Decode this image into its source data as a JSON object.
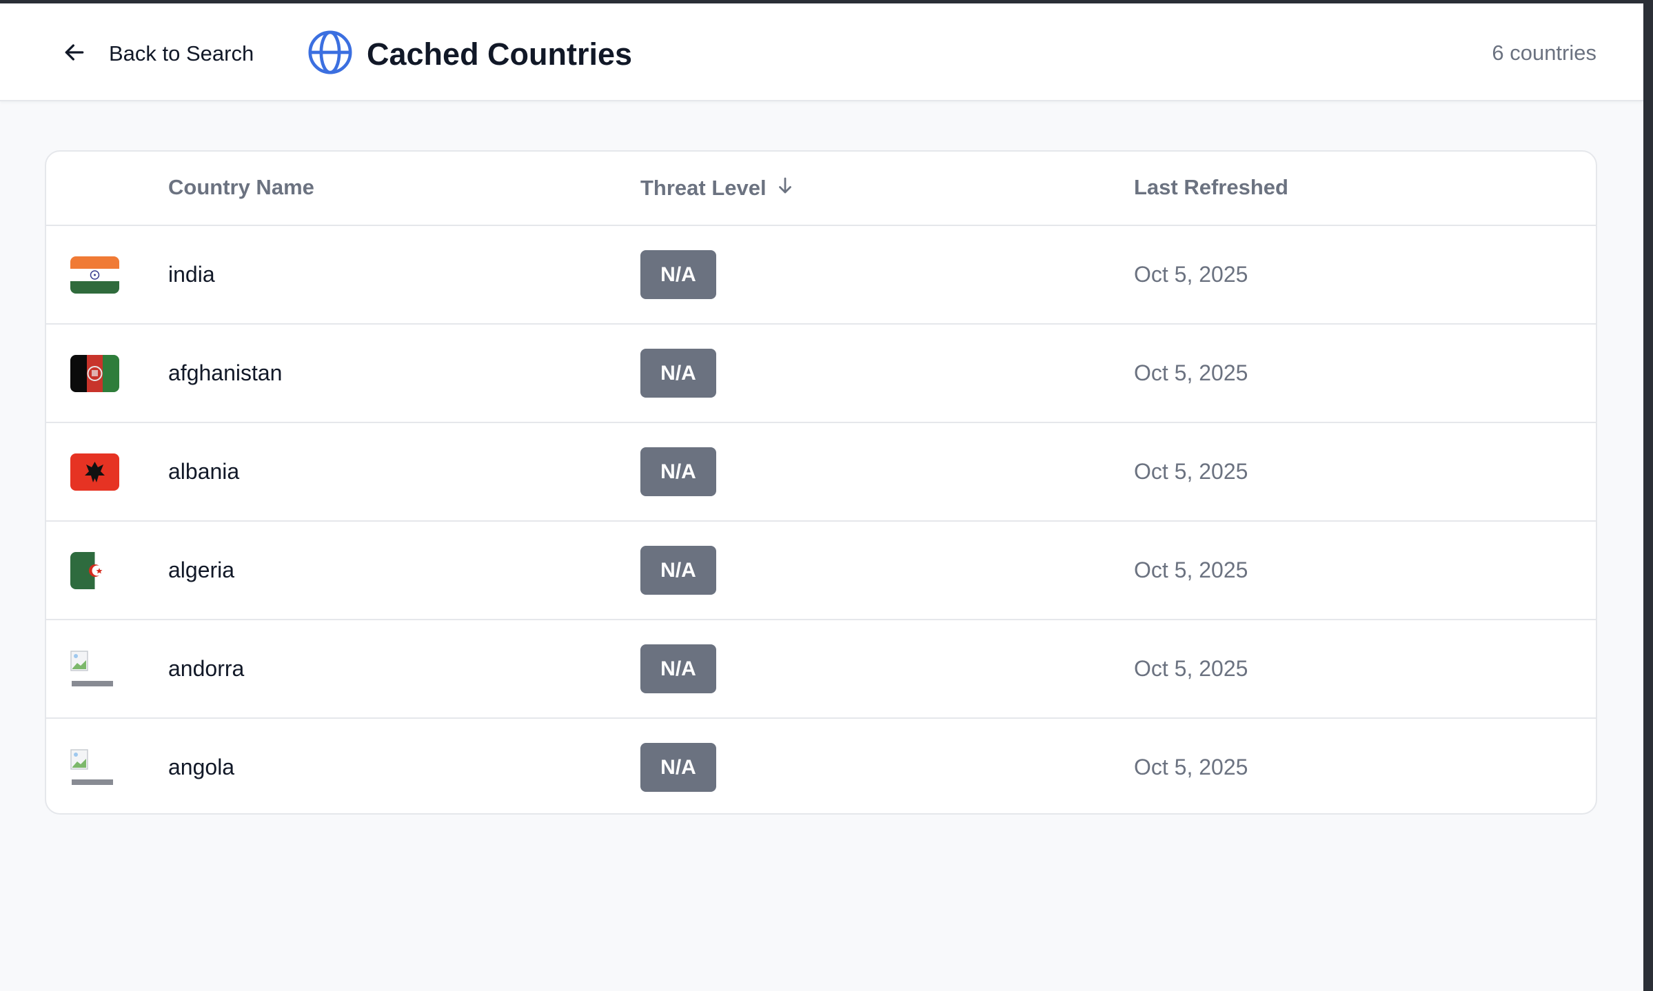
{
  "header": {
    "back_label": "Back to Search",
    "title": "Cached Countries",
    "count": "6 countries",
    "accent": "#3b6fe0"
  },
  "table": {
    "columns": [
      "",
      "Country Name",
      "Threat Level",
      "Last Refreshed"
    ],
    "sort": {
      "column": "Threat Level",
      "direction": "descending",
      "icon": "arrow-down-icon"
    },
    "rows": [
      {
        "flag": "india-flag",
        "name": "india",
        "threat": "N/A",
        "refreshed": "Oct 5, 2025"
      },
      {
        "flag": "afghanistan-flag",
        "name": "afghanistan",
        "threat": "N/A",
        "refreshed": "Oct 5, 2025"
      },
      {
        "flag": "albania-flag",
        "name": "albania",
        "threat": "N/A",
        "refreshed": "Oct 5, 2025"
      },
      {
        "flag": "algeria-flag",
        "name": "algeria",
        "threat": "N/A",
        "refreshed": "Oct 5, 2025"
      },
      {
        "flag": "broken-image-icon",
        "name": "andorra",
        "threat": "N/A",
        "refreshed": "Oct 5, 2025"
      },
      {
        "flag": "broken-image-icon",
        "name": "angola",
        "threat": "N/A",
        "refreshed": "Oct 5, 2025"
      }
    ]
  },
  "colors": {
    "badge_bg": "#6b7280",
    "muted_text": "#6b7280",
    "page_bg": "#f8f9fb"
  }
}
